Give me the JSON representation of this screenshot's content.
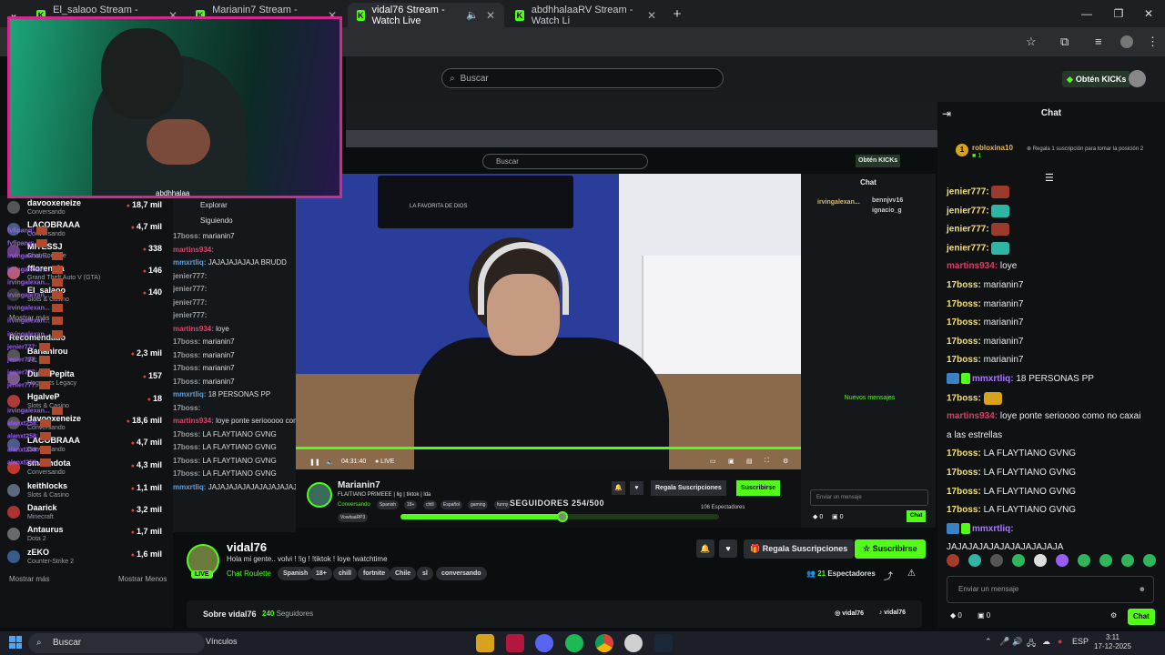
{
  "browser": {
    "tabs": [
      {
        "label": "El_salaoo Stream - Watch Live",
        "active": false
      },
      {
        "label": "Marianin7 Stream - Watch Live",
        "active": false
      },
      {
        "label": "vidal76 Stream - Watch Live",
        "active": true
      },
      {
        "label": "abdhhalaaRV Stream - Watch Li",
        "active": false
      }
    ],
    "new_tab": "+",
    "close": "✕",
    "minimize": "—",
    "maximize": "❐"
  },
  "header": {
    "search_placeholder": "Buscar",
    "kicks_label": "Obtén KICKs"
  },
  "webcam": {
    "label": "abdhhalaa"
  },
  "sidebar": {
    "following": [
      {
        "name": "davooxeneize",
        "category": "Conversando",
        "viewers": "18,7 mil"
      },
      {
        "name": "LACOBRAAA",
        "category": "Conversando",
        "viewers": "4,7 mil"
      },
      {
        "name": "MITESSJ",
        "category": "Chat Roulette",
        "viewers": "338"
      },
      {
        "name": "fflorencia",
        "category": "Grand Theft Auto V (GTA)",
        "viewers": "146"
      },
      {
        "name": "El_salaoo",
        "category": "Slots & Casino",
        "viewers": "140"
      }
    ],
    "show_more": "Mostrar más",
    "recommended_label": "Recomendado",
    "recommended": [
      {
        "name": "Bananirou",
        "category": "IRL",
        "viewers": "2,3 mil"
      },
      {
        "name": "DulcePepita",
        "category": "Hogwarts Legacy",
        "viewers": "157"
      },
      {
        "name": "HgalveP",
        "category": "Slots & Casino",
        "viewers": "18"
      },
      {
        "name": "davooxeneize",
        "category": "Conversando",
        "viewers": "18,6 mil"
      },
      {
        "name": "LACOBRAAA",
        "category": "Conversando",
        "viewers": "4,7 mil"
      },
      {
        "name": "smashdota",
        "category": "Conversando",
        "viewers": "4,3 mil"
      },
      {
        "name": "keithlocks",
        "category": "Slots & Casino",
        "viewers": "1,1 mil"
      },
      {
        "name": "Daarick",
        "category": "Minecraft",
        "viewers": "3,2 mil"
      },
      {
        "name": "Antaurus",
        "category": "Dota 2",
        "viewers": "1,7 mil"
      },
      {
        "name": "zEKO",
        "category": "Counter-Strike 2",
        "viewers": "1,6 mil"
      }
    ],
    "show_more_2": "Mostrar más",
    "show_less": "Mostrar Menos"
  },
  "inner_overlay": {
    "explorar": "Explorar",
    "siguiendo": "Siguiendo",
    "lines": [
      {
        "user": "17boss:",
        "msg": "marianin7",
        "style": "gray"
      },
      {
        "user": "martins934:",
        "msg": "",
        "style": "rose"
      },
      {
        "user": "mmxrtliq:",
        "msg": "JAJAJAJAJAJA BRUDD",
        "style": "blue"
      },
      {
        "user": "jenier777:",
        "msg": "",
        "style": "gray"
      },
      {
        "user": "jenier777:",
        "msg": "",
        "style": "gray"
      },
      {
        "user": "jenier777:",
        "msg": "",
        "style": "gray"
      },
      {
        "user": "jenier777:",
        "msg": "",
        "style": "gray"
      },
      {
        "user": "martins934:",
        "msg": "loye",
        "style": "rose"
      },
      {
        "user": "17boss:",
        "msg": "marianin7",
        "style": "gray"
      },
      {
        "user": "17boss:",
        "msg": "marianin7",
        "style": "gray"
      },
      {
        "user": "17boss:",
        "msg": "marianin7",
        "style": "gray"
      },
      {
        "user": "17boss:",
        "msg": "marianin7",
        "style": "gray"
      },
      {
        "user": "mmxrtliq:",
        "msg": "18 PERSONAS PP",
        "style": "blue"
      },
      {
        "user": "17boss:",
        "msg": "",
        "style": "gray"
      },
      {
        "user": "martins934:",
        "msg": "loye ponte seriooooo como no caxai a las estrellas",
        "style": "rose"
      },
      {
        "user": "17boss:",
        "msg": "LA FLAYTIANO GVNG",
        "style": "gray"
      },
      {
        "user": "17boss:",
        "msg": "LA FLAYTIANO GVNG",
        "style": "gray"
      },
      {
        "user": "17boss:",
        "msg": "LA FLAYTIANO GVNG",
        "style": "gray"
      },
      {
        "user": "17boss:",
        "msg": "LA FLAYTIANO GVNG",
        "style": "gray"
      },
      {
        "user": "mmxrtliq:",
        "msg": "JAJAJAJAJAJAJAJAJAJAJA",
        "style": "blue"
      }
    ],
    "inner_search": "Buscar",
    "inner_kicks": "Obtén KICKs",
    "tv_text": "LA FAVORITA DE DIOS",
    "video_time": "04:31:40",
    "video_live": "● LIVE",
    "chat_header": "Chat",
    "chat_top_users": [
      "irvingalexan...",
      "bennjvv16",
      "ignacio_g"
    ],
    "chat_lines": [
      "fvfipanq:",
      "fvfipanq:",
      "irvingalexan...",
      "irvingalexan...",
      "irvingalexan...",
      "irvingalexan...",
      "irvingalexan...",
      "irvingalexan...",
      "irvingalexan...",
      "jenier777:",
      "jenier777:",
      "jenier777:",
      "jenier777:"
    ],
    "nuevos": "Nuevos mensajes",
    "chat_lines_2": [
      "irvingalexan...",
      "alanxt258:",
      "alanxt258:",
      "alanxt258:",
      "alanxt258:"
    ],
    "channel_name": "Marianin7",
    "channel_title": "FLAITIANO PRIMEEE | lig | tiktok | lda",
    "channel_category": "Conversando",
    "channel_tags": [
      "Spanish",
      "18+",
      "chill",
      "Español",
      "gaming",
      "funny",
      "VowitaaRP3"
    ],
    "sub_label": "Regala Suscripciones",
    "follow_label": "Suscribirse",
    "goal_label": "SEGUIDORES 254/500",
    "goal_value": 254,
    "goal_max": 500,
    "viewers": "106 Espectadores",
    "chat_input": "Enviar un mensaje",
    "chat_btn": "Chat",
    "counts": [
      "0",
      "0"
    ]
  },
  "stream": {
    "name": "vidal76",
    "live": "LIVE",
    "title": "Hola mi gente.. volvi ! !ig ! !tiktok ! loye !watchtime",
    "category": "Chat Roulette",
    "tags": [
      "Spanish",
      "18+",
      "chill",
      "fortnite",
      "Chile",
      "sl",
      "conversando"
    ],
    "sub_label": "Regala Suscripciones",
    "follow_label": "Suscribirse",
    "viewers_count": "21",
    "viewers_label": "Espectadores",
    "about_label": "Sobre vidal76",
    "followers_count": "240",
    "followers_label": "Seguidores",
    "instagram": "vidal76",
    "tiktok": "vidal76"
  },
  "chat": {
    "header": "Chat",
    "pinned": {
      "user": "robloxina10",
      "gifts": "1",
      "message": "Regala 1 suscripción para tomar la posición 2"
    },
    "messages": [
      {
        "user": "jenier777:",
        "text": "",
        "color": "ly",
        "emote": "#9b3b2b"
      },
      {
        "user": "jenier777:",
        "text": "",
        "color": "ly",
        "emote": "#2fb5a3"
      },
      {
        "user": "jenier777:",
        "text": "",
        "color": "ly",
        "emote": "#9b3b2b"
      },
      {
        "user": "jenier777:",
        "text": "",
        "color": "ly",
        "emote": "#2fb5a3"
      },
      {
        "user": "martins934:",
        "text": "loye",
        "color": "mg",
        "emote": ""
      },
      {
        "user": "17boss:",
        "text": "marianin7",
        "color": "ly",
        "emote": ""
      },
      {
        "user": "17boss:",
        "text": "marianin7",
        "color": "ly",
        "emote": ""
      },
      {
        "user": "17boss:",
        "text": "marianin7",
        "color": "ly",
        "emote": ""
      },
      {
        "user": "17boss:",
        "text": "marianin7",
        "color": "ly",
        "emote": ""
      },
      {
        "user": "17boss:",
        "text": "marianin7",
        "color": "ly",
        "emote": ""
      },
      {
        "user": "mmxrtliq:",
        "text": "18 PERSONAS PP",
        "color": "pu",
        "emote": "",
        "badges": true
      },
      {
        "user": "17boss:",
        "text": "",
        "color": "ly",
        "emote": "#d8a31c"
      },
      {
        "user": "martins934:",
        "text": "loye ponte serioooo como no caxai",
        "color": "mg",
        "emote": ""
      },
      {
        "user": "",
        "text": "a las estrellas",
        "color": "",
        "emote": ""
      },
      {
        "user": "17boss:",
        "text": "LA FLAYTIANO GVNG",
        "color": "ly",
        "emote": ""
      },
      {
        "user": "17boss:",
        "text": "LA FLAYTIANO GVNG",
        "color": "ly",
        "emote": ""
      },
      {
        "user": "17boss:",
        "text": "LA FLAYTIANO GVNG",
        "color": "ly",
        "emote": ""
      },
      {
        "user": "17boss:",
        "text": "LA FLAYTIANO GVNG",
        "color": "ly",
        "emote": ""
      },
      {
        "user": "mmxrtliq:",
        "text": "",
        "color": "pu",
        "emote": "",
        "badges": true
      },
      {
        "user": "",
        "text": "JAJAJAJAJAJAJAJAJAJAJA",
        "color": "",
        "emote": ""
      }
    ],
    "emote_colors": [
      "#a83c2c",
      "#2fb5a3",
      "#555",
      "#2fb55a",
      "#ddd",
      "#9c5bf7",
      "#2fb55a",
      "#2fb55a",
      "#2fb55a",
      "#2fb55a"
    ],
    "input_placeholder": "Enviar un mensaje",
    "kicks": "0",
    "subs": "0",
    "send_label": "Chat"
  },
  "taskbar": {
    "search": "Buscar",
    "vinculos": "Vínculos",
    "lang": "ESP",
    "time": "3:11",
    "date": "17-12-2025"
  }
}
